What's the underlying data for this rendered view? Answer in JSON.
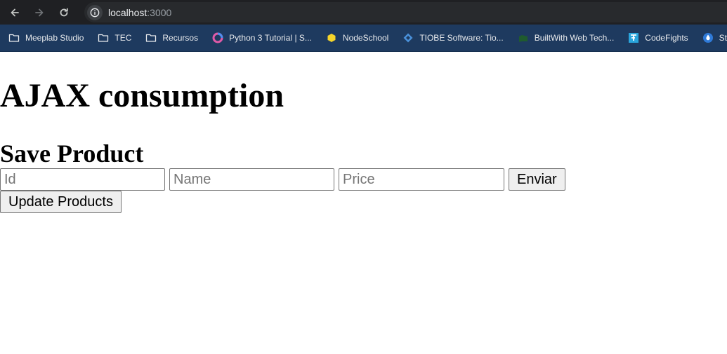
{
  "browser": {
    "url_host": "localhost",
    "url_port": ":3000",
    "bookmarks": [
      {
        "label": "Meeplab Studio",
        "icon": "folder-icon"
      },
      {
        "label": "TEC",
        "icon": "folder-icon"
      },
      {
        "label": "Recursos",
        "icon": "folder-icon"
      },
      {
        "label": "Python 3 Tutorial | S...",
        "icon": "python-tutorial-icon"
      },
      {
        "label": "NodeSchool",
        "icon": "nodeschool-icon"
      },
      {
        "label": "TIOBE Software: Tio...",
        "icon": "tiobe-icon"
      },
      {
        "label": "BuiltWith Web Tech...",
        "icon": "builtwith-icon"
      },
      {
        "label": "CodeFights",
        "icon": "codefights-icon"
      },
      {
        "label": "Styling & Cust",
        "icon": "styling-icon"
      }
    ]
  },
  "page": {
    "title": "AJAX consumption",
    "subtitle": "Save Product",
    "form": {
      "id_placeholder": "Id",
      "name_placeholder": "Name",
      "price_placeholder": "Price",
      "submit_label": "Enviar"
    },
    "update_label": "Update Products"
  }
}
